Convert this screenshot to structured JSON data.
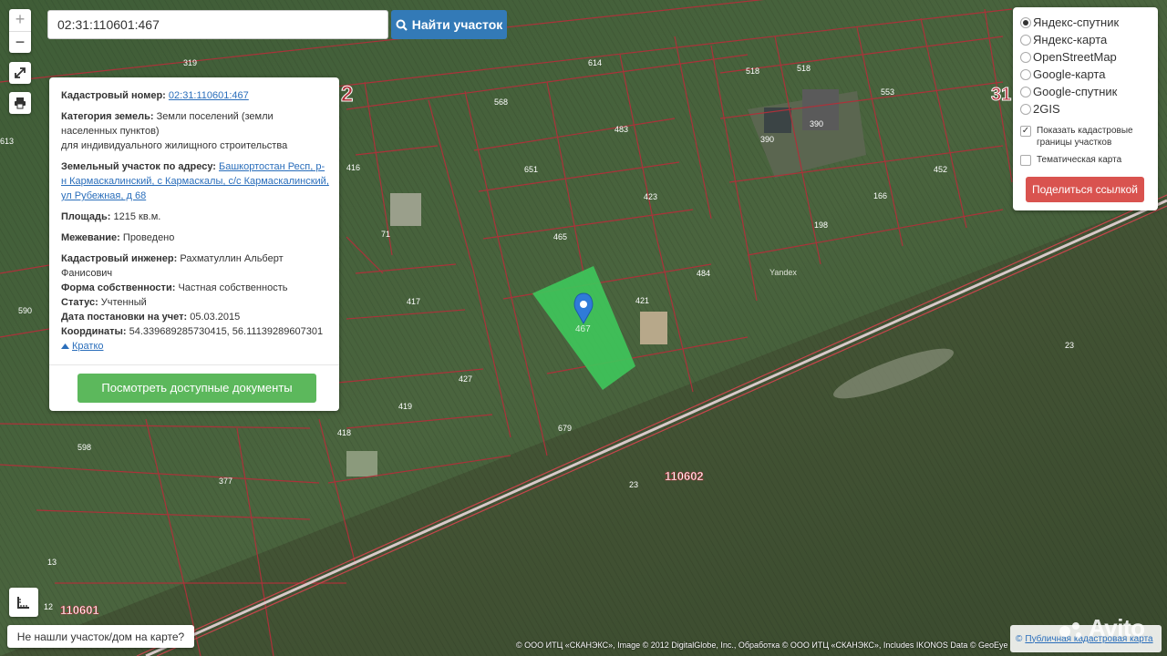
{
  "controls": {
    "zoom_in": "+",
    "zoom_out": "−"
  },
  "search": {
    "value": "02:31:110601:467",
    "button_label": "Найти участок"
  },
  "info_card": {
    "cadastral_label": "Кадастровый номер:",
    "cadastral_number": "02:31:110601:467",
    "category_label": "Категория земель:",
    "category_value": "Земли поселений (земли населенных пунктов)",
    "category_sub": "для индивидуального жилищного строительства",
    "address_label": "Земельный участок по адресу:",
    "address_value": "Башкортостан Респ, р-н Кармаскалинский, с Кармаскалы, с/с Кармаскалинский, ул Рубежная, д 68",
    "area_label": "Площадь:",
    "area_value": "1215 кв.м.",
    "survey_label": "Межевание:",
    "survey_value": "Проведено",
    "engineer_label": "Кадастровый инженер:",
    "engineer_value": "Рахматуллин Альберт Фанисович",
    "ownership_label": "Форма собственности:",
    "ownership_value": "Частная собственность",
    "status_label": "Статус:",
    "status_value": "Учтенный",
    "date_label": "Дата постановки на учет:",
    "date_value": "05.03.2015",
    "coords_label": "Координаты:",
    "coords_value": "54.339689285730415, 56.11139289607301",
    "collapse_label": "Кратко",
    "docs_button": "Посмотреть доступные документы"
  },
  "layers": {
    "items": [
      {
        "label": "Яндекс-спутник",
        "selected": true
      },
      {
        "label": "Яндекс-карта",
        "selected": false
      },
      {
        "label": "OpenStreetMap",
        "selected": false
      },
      {
        "label": "Google-карта",
        "selected": false
      },
      {
        "label": "Google-спутник",
        "selected": false
      },
      {
        "label": "2GIS",
        "selected": false
      }
    ],
    "show_borders": {
      "label": "Показать кадастровые границы участков",
      "checked": true
    },
    "thematic": {
      "label": "Тематическая карта",
      "checked": false
    },
    "share_button": "Поделиться ссылкой"
  },
  "map_labels": {
    "parcels": [
      "319",
      "614",
      "568",
      "483",
      "651",
      "423",
      "465",
      "484",
      "421",
      "417",
      "427",
      "419",
      "418",
      "598",
      "377",
      "679",
      "23",
      "518",
      "518",
      "553",
      "390",
      "390",
      "452",
      "166",
      "198",
      "416",
      "71",
      "590",
      "613",
      "12",
      "13",
      "23"
    ],
    "quarter_1": "110602",
    "quarter_2": "110601",
    "big_1": "2",
    "big_2": "31",
    "yandex": "Yandex"
  },
  "footer": {
    "not_found": "Не нашли участок/дом на карте?",
    "attribution": "© ООО ИТЦ «СКАНЭКС», Image © 2012 DigitalGlobe, Inc., Обработка © ООО ИТЦ «СКАНЭКС», Includes IKONOS Data © GeoEye",
    "public_map": "Публичная кадастровая карта",
    "avito": "Avito"
  },
  "colors": {
    "parcel_highlight": "#3fc45a",
    "border": "#b0303a",
    "marker": "#2f7bd8",
    "primary_btn": "#337ab7",
    "success_btn": "#5cb85c",
    "danger_btn": "#d9534f"
  }
}
